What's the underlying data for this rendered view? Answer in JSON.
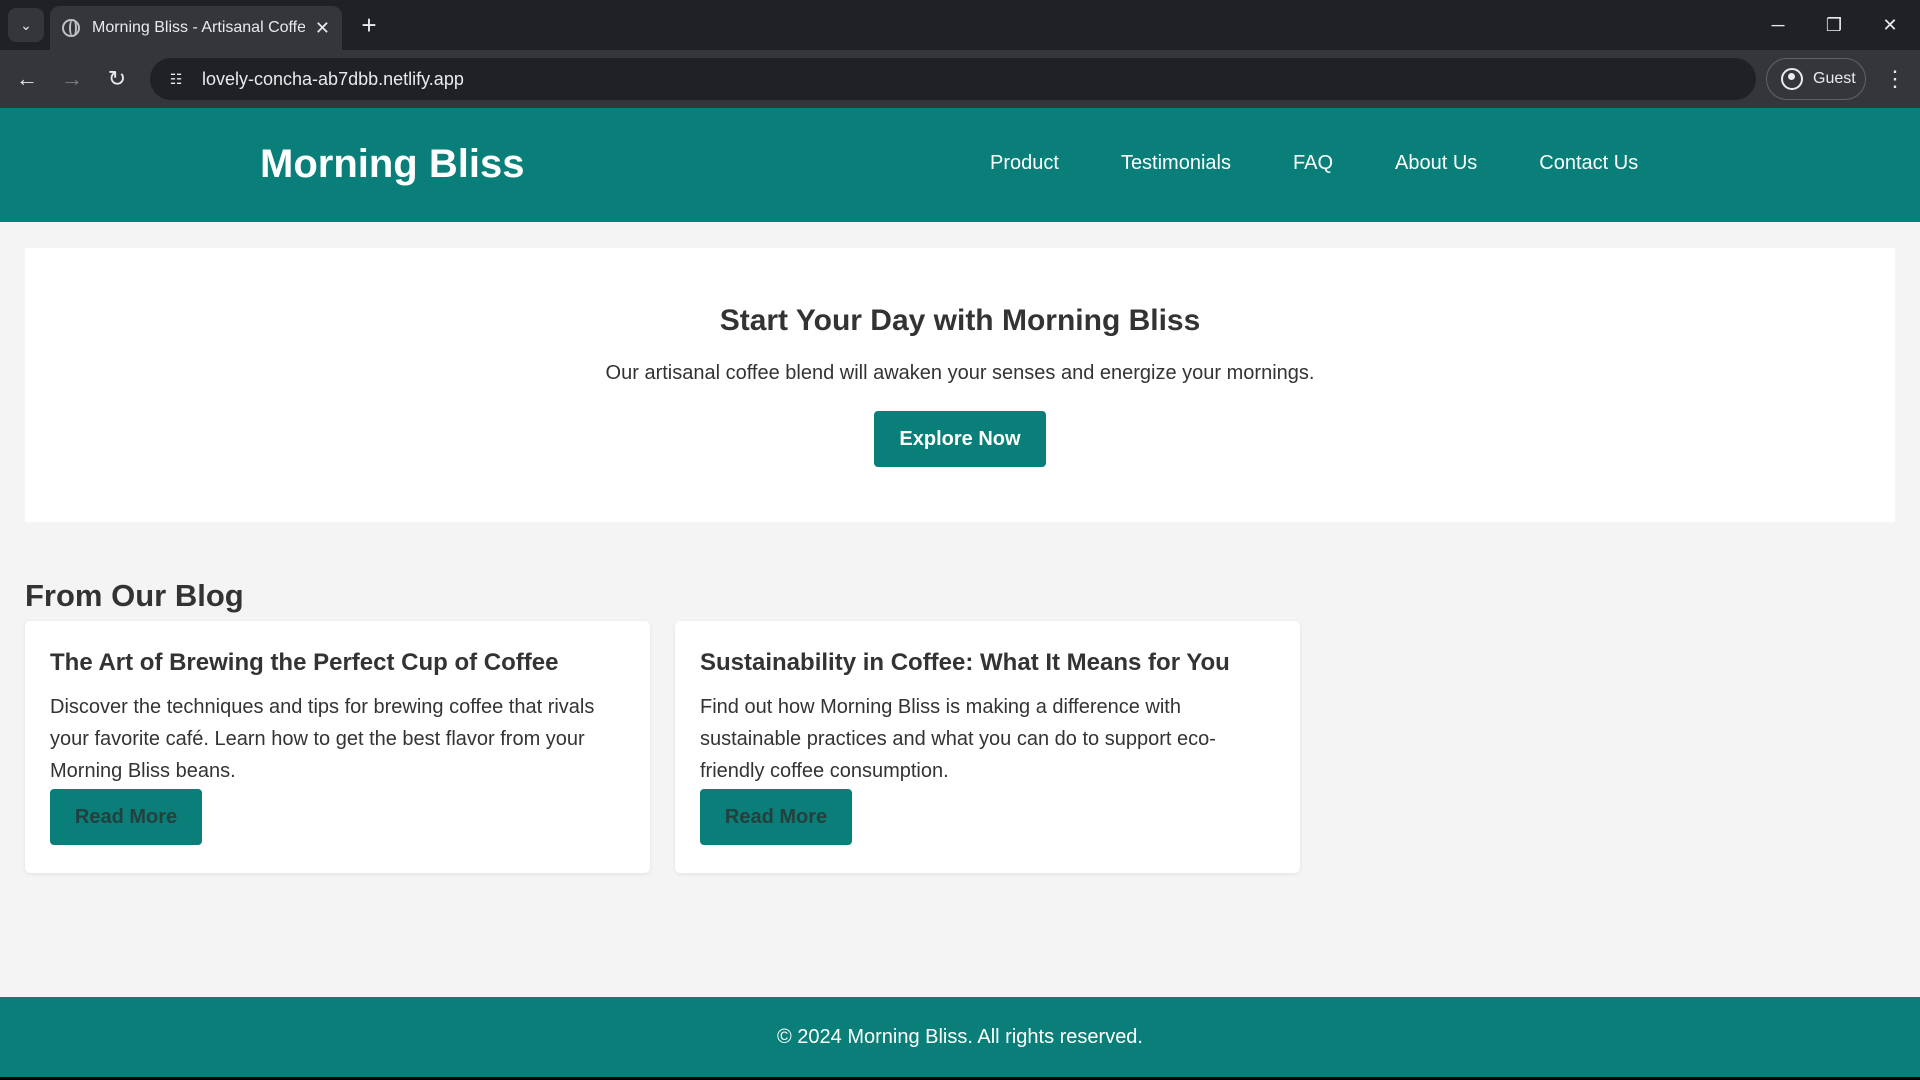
{
  "browser": {
    "tab_title": "Morning Bliss - Artisanal Coffee",
    "url": "lovely-concha-ab7dbb.netlify.app",
    "profile_label": "Guest"
  },
  "site": {
    "logo": "Morning Bliss",
    "nav": [
      "Product",
      "Testimonials",
      "FAQ",
      "About Us",
      "Contact Us"
    ]
  },
  "hero": {
    "title": "Start Your Day with Morning Bliss",
    "subtitle": "Our artisanal coffee blend will awaken your senses and energize your mornings.",
    "cta": "Explore Now"
  },
  "blog": {
    "heading": "From Our Blog",
    "posts": [
      {
        "title": "The Art of Brewing the Perfect Cup of Coffee",
        "excerpt": "Discover the techniques and tips for brewing coffee that rivals your favorite café. Learn how to get the best flavor from your Morning Bliss beans.",
        "button": "Read More"
      },
      {
        "title": "Sustainability in Coffee: What It Means for You",
        "excerpt": "Find out how Morning Bliss is making a difference with sustainable practices and what you can do to support eco-friendly coffee consumption.",
        "button": "Read More"
      }
    ]
  },
  "footer": {
    "copyright": "© 2024 Morning Bliss. All rights reserved."
  },
  "colors": {
    "brand": "#0a7e78",
    "chrome_dark": "#202124",
    "chrome_mid": "#35363a"
  }
}
